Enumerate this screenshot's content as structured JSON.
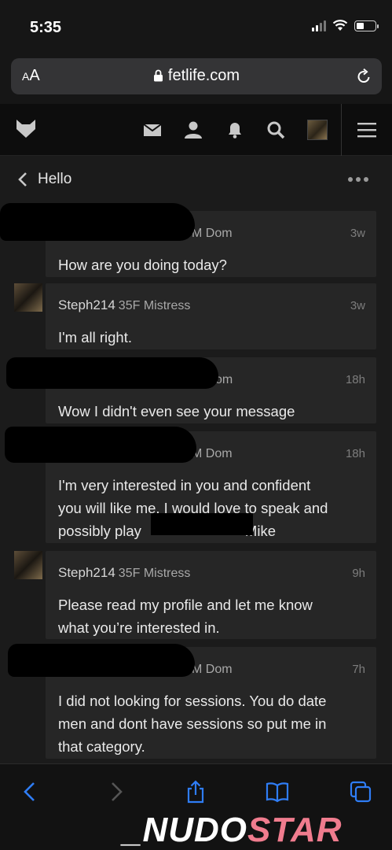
{
  "status_bar": {
    "time": "5:35"
  },
  "browser": {
    "text_size_label": "AA",
    "url": "fetlife.com"
  },
  "site_nav": {
    "icons": [
      "logo-icon",
      "mail-icon",
      "person-icon",
      "bell-icon",
      "search-icon",
      "avatar",
      "menu-icon"
    ]
  },
  "conversation": {
    "title": "Hello"
  },
  "messages": [
    {
      "name": "",
      "meta": "M Dom",
      "time": "3w",
      "body": "How are you doing today?"
    },
    {
      "name": "Steph214",
      "meta": "35F Mistress",
      "time": "3w",
      "body": "I'm all right."
    },
    {
      "name": "",
      "meta": "om",
      "time": "18h",
      "body": "Wow I didn't even see your message"
    },
    {
      "name": "",
      "meta": "M Dom",
      "time": "18h",
      "body_lines": [
        "I'm very interested in you and confident",
        "you will like me. I would love to speak and",
        "possibly play",
        "Mike"
      ]
    },
    {
      "name": "Steph214",
      "meta": "35F Mistress",
      "time": "9h",
      "body_lines": [
        "Please read my profile and let me know",
        "what you’re interested in."
      ]
    },
    {
      "name": "",
      "meta": "M Dom",
      "time": "7h",
      "body_lines": [
        "I did not looking for sessions. You do date",
        "men and dont have sessions so put me in",
        "that category."
      ]
    }
  ],
  "watermark": {
    "part1": "_NUDO",
    "part2": "STAR"
  },
  "colors": {
    "background": "#1b1b1b",
    "bubble": "#262626",
    "nav": "#0d0d0d",
    "accent_ios": "#2f7df6",
    "watermark_pink": "#f07c8e"
  }
}
